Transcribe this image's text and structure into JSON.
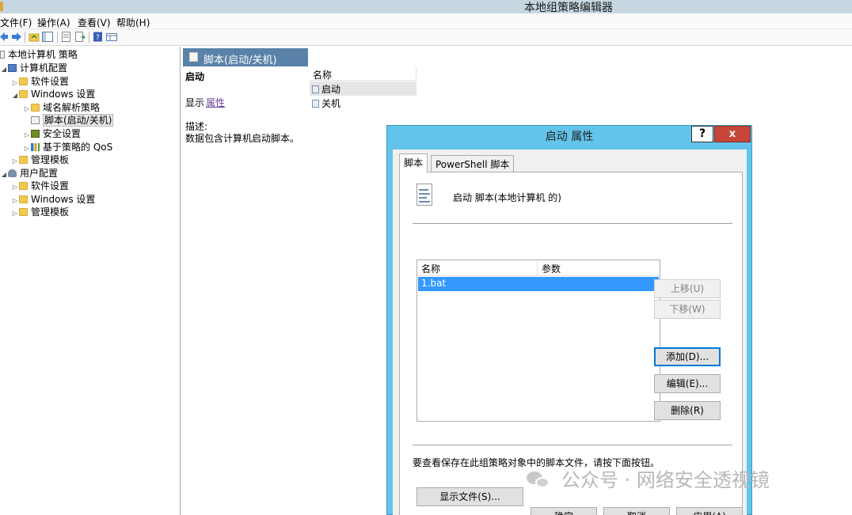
{
  "window": {
    "title": "本地组策略编辑器"
  },
  "menu": {
    "file": "文件(F)",
    "action": "操作(A)",
    "view": "查看(V)",
    "help": "帮助(H)"
  },
  "tree": {
    "root": "本地计算机 策略",
    "computer_config": "计算机配置",
    "software_settings": "软件设置",
    "windows_settings": "Windows 设置",
    "name_resolution_policy": "域名解析策略",
    "scripts": "脚本(启动/关机)",
    "security_settings": "安全设置",
    "qos": "基于策略的 QoS",
    "admin_templates": "管理模板",
    "user_config": "用户配置",
    "user_software_settings": "软件设置",
    "user_windows_settings": "Windows 设置",
    "user_admin_templates": "管理模板"
  },
  "middle": {
    "header": "脚本(启动/关机)",
    "selected_title": "启动",
    "show_label": "显示",
    "properties_link": "属性",
    "description_label": "描述:",
    "description_text": "数据包含计算机启动脚本。",
    "column_name": "名称",
    "items": [
      "启动",
      "关机"
    ]
  },
  "dialog": {
    "title": "启动 属性",
    "help": "?",
    "close": "x",
    "tabs": [
      "脚本",
      "PowerShell 脚本"
    ],
    "heading": "启动 脚本(本地计算机 的)",
    "table_headers": [
      "名称",
      "参数"
    ],
    "rows": [
      {
        "name": "1.bat",
        "params": ""
      }
    ],
    "buttons": {
      "up": "上移(U)",
      "down": "下移(W)",
      "add": "添加(D)...",
      "edit": "编辑(E)...",
      "remove": "删除(R)",
      "show_files": "显示文件(S)...",
      "ok": "确定",
      "cancel": "取消",
      "apply": "应用(A)"
    },
    "hint": "要查看保存在此组策略对象中的脚本文件，请按下面按钮。"
  },
  "watermark": {
    "text": "公众号 · 网络安全透视镜"
  }
}
